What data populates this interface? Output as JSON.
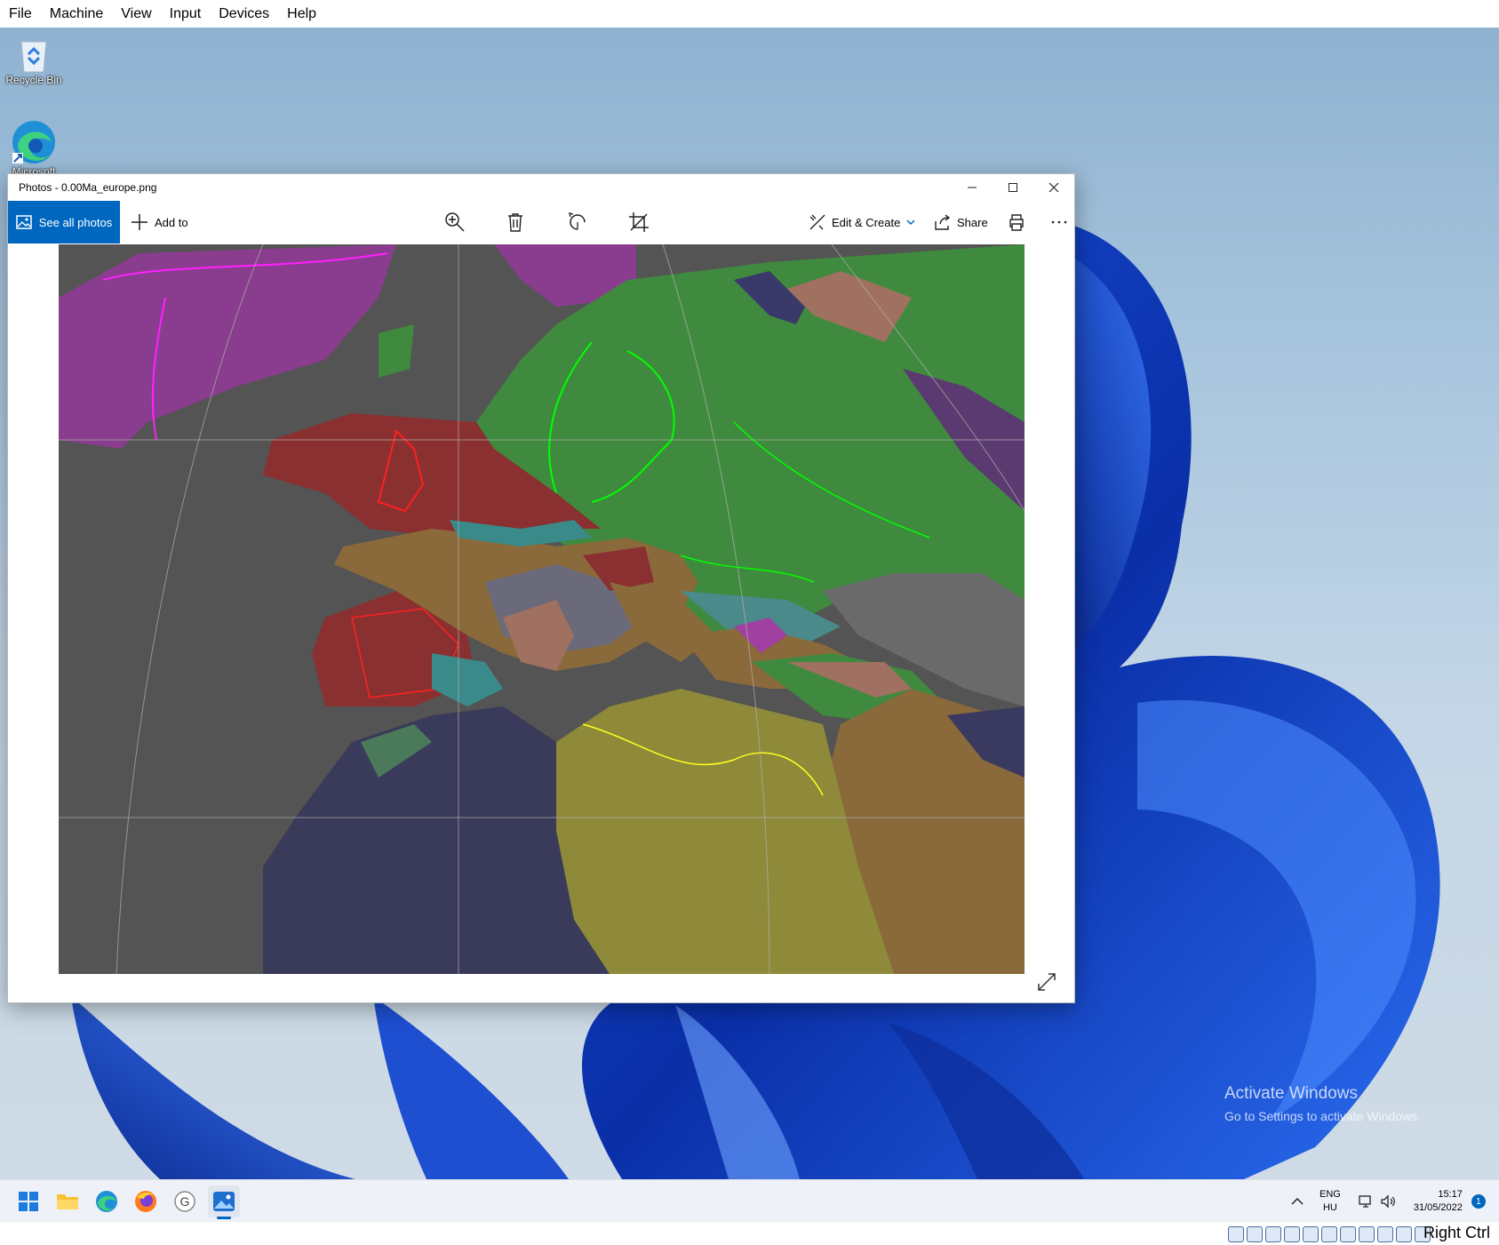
{
  "host_menu": [
    "File",
    "Machine",
    "View",
    "Input",
    "Devices",
    "Help"
  ],
  "desktop": {
    "recycle_bin": "Recycle Bin",
    "edge_label": "Microsoft",
    "activate_title": "Activate Windows",
    "activate_sub": "Go to Settings to activate Windows."
  },
  "window": {
    "title": "Photos - 0.00Ma_europe.png",
    "see_all": "See all photos",
    "add_to": "Add to",
    "edit_create": "Edit & Create",
    "share": "Share",
    "icons": [
      "zoom-in-icon",
      "delete-icon",
      "rotate-icon",
      "crop-icon",
      "print-icon",
      "more-icon",
      "expand-icon"
    ]
  },
  "taskbar": {
    "apps": [
      "start-icon",
      "file-explorer-icon",
      "edge-icon",
      "firefox-icon",
      "gimp-icon",
      "photos-icon"
    ],
    "lang_top": "ENG",
    "lang_bottom": "HU",
    "time": "15:17",
    "date": "31/05/2022",
    "notifications": "1"
  },
  "host_status": {
    "key": "Right Ctrl"
  },
  "colors": {
    "accent": "#0067c0",
    "ocean": "#545454",
    "eurasia": "#3f8a3f",
    "africa": "#8e8a3a"
  }
}
